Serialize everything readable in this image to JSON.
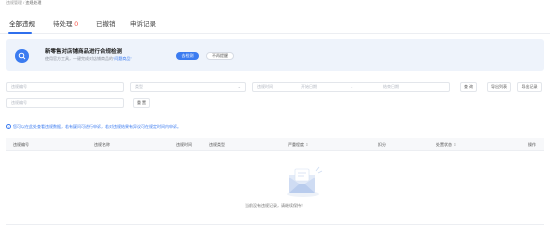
{
  "breadcrumb": {
    "parent": "违规管理",
    "separator": "/",
    "current": "违规处理"
  },
  "tabs": [
    {
      "label": "全部违规",
      "count": ""
    },
    {
      "label": "待处理",
      "count": "0"
    },
    {
      "label": "已撤销",
      "count": ""
    },
    {
      "label": "申诉记录",
      "count": ""
    }
  ],
  "banner": {
    "title": "新零售对店铺商品进行合规检测",
    "desc_prefix": "使用官方工具，一键完成对店铺商品的",
    "desc_highlight": "“问题商品”",
    "primary_button": "去检测",
    "secondary_button": "不再提醒"
  },
  "filters": {
    "violation_no_placeholder": "违规编号",
    "type_placeholder": "类型",
    "date_label": "违规时间",
    "date_start_placeholder": "开始日期",
    "date_sep": "-",
    "date_end_placeholder": "结束日期",
    "query_button": "查 询",
    "export_button": "导出列表",
    "export_record_button": "导出记录",
    "product_no_placeholder": "违规编号",
    "reset_button": "重 置"
  },
  "info": {
    "icon": "i",
    "text": "您可以在此处查看违规数据，若有疑问可进行申诉，若对违规结果有异议可在规定时间内申诉。"
  },
  "table": {
    "headers": [
      "违规编号",
      "违规名称",
      "违规时间",
      "违规类型",
      "严重程度",
      "扣分",
      "处置状态",
      "操作"
    ],
    "sort_symbol": "⇕"
  },
  "empty": {
    "text": "当前没有违规记录，请继续保持！"
  },
  "colors": {
    "accent": "#3b7bf0",
    "danger": "#f5483b"
  }
}
